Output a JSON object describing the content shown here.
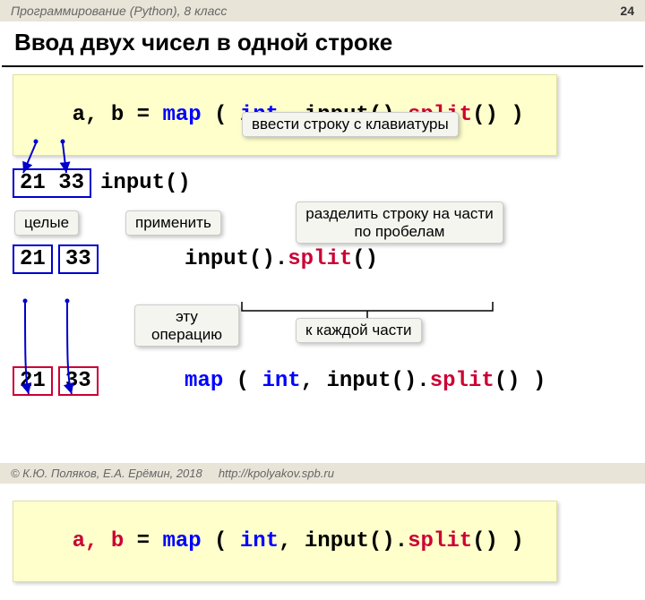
{
  "header": {
    "course": "Программирование (Python), 8 класс",
    "page": "24"
  },
  "title": "Ввод двух чисел в одной строке",
  "code1": {
    "p1": "a, b = ",
    "p2": "map ",
    "p3": "( ",
    "p4": "int",
    "p5": ", input().",
    "p6": "split",
    "p7": "() )"
  },
  "step1": {
    "box": "21 33",
    "code": "input()"
  },
  "step2": {
    "b1": "21",
    "b2": "33",
    "code_a": "input().",
    "code_b": "split",
    "code_c": "()"
  },
  "step3": {
    "b1": "21",
    "b2": "33",
    "p1": "map ",
    "p2": "( ",
    "p3": "int",
    "p4": ", input().",
    "p5": "split",
    "p6": "() )"
  },
  "code2": {
    "p1": "a, b",
    "p2": " = ",
    "p3": "map ",
    "p4": "( ",
    "p5": "int",
    "p6": ", input().",
    "p7": "split",
    "p8": "() )"
  },
  "callouts": {
    "c1": "ввести строку с клавиатуры",
    "c2": "целые",
    "c3": "применить",
    "c4": "разделить строку на части по пробелам",
    "c5": "эту операцию",
    "c6": "к каждой части"
  },
  "footer": {
    "copy": "© К.Ю. Поляков, Е.А. Ерёмин, 2018",
    "url": "http://kpolyakov.spb.ru"
  }
}
